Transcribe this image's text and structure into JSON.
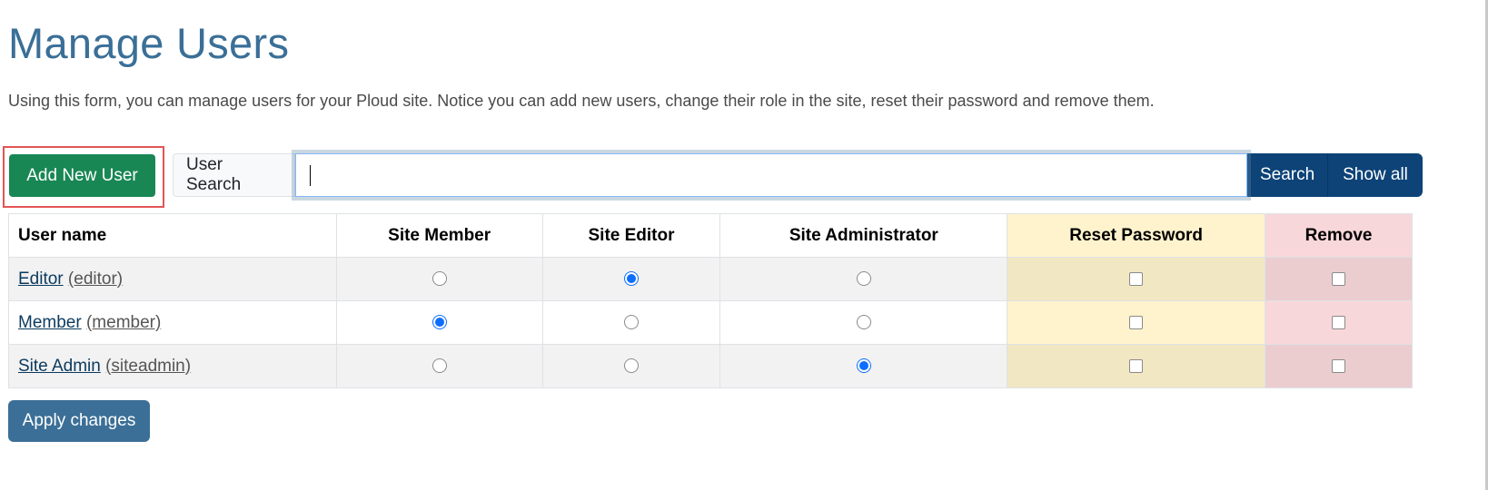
{
  "page": {
    "title": "Manage Users",
    "intro": "Using this form, you can manage users for your Ploud site. Notice you can add new users, change their role in the site, reset their password and remove them."
  },
  "toolbar": {
    "add_user_label": "Add New User",
    "search_label": "User Search",
    "search_value": "",
    "search_button": "Search",
    "show_all_button": "Show all"
  },
  "table": {
    "headers": {
      "user_name": "User name",
      "site_member": "Site Member",
      "site_editor": "Site Editor",
      "site_admin": "Site Administrator",
      "reset_password": "Reset Password",
      "remove": "Remove"
    },
    "rows": [
      {
        "name": "Editor",
        "id": "(editor)",
        "role": "editor",
        "reset": false,
        "remove": false
      },
      {
        "name": "Member",
        "id": "(member)",
        "role": "member",
        "reset": false,
        "remove": false
      },
      {
        "name": "Site Admin",
        "id": "(siteadmin)",
        "role": "admin",
        "reset": false,
        "remove": false
      }
    ]
  },
  "footer": {
    "apply_label": "Apply changes"
  },
  "colors": {
    "heading": "#3a6f97",
    "add_button": "#198754",
    "search_buttons": "#0d4377",
    "apply_button": "#3b6f97",
    "reset_column": "#fff3cd",
    "remove_column": "#f8d7da",
    "highlight_outline": "#e25555"
  }
}
